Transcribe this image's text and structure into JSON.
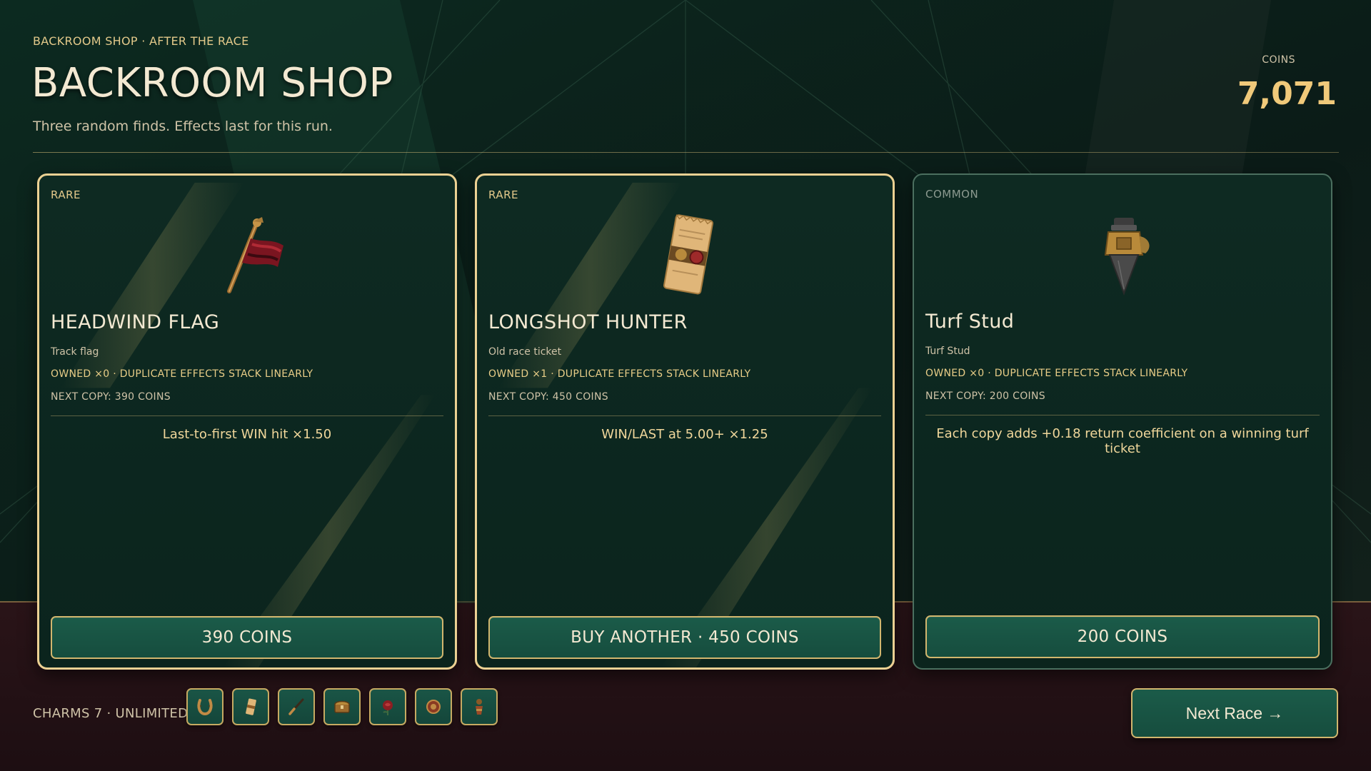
{
  "header": {
    "eyebrow": "BACKROOM SHOP · AFTER THE RACE",
    "title": "BACKROOM SHOP",
    "subtitle": "Three random finds. Effects last for this run.",
    "coins_label": "COINS",
    "coins_value": "7,071"
  },
  "cards": [
    {
      "rarity": "RARE",
      "icon": "headwind-flag-icon",
      "name": "HEADWIND FLAG",
      "subtitle": "Track flag",
      "owned": "OWNED ×0 · DUPLICATE EFFECTS STACK LINEARLY",
      "next_copy": "NEXT COPY: 390 COINS",
      "effect": "Last-to-first WIN hit ×1.50",
      "button": "390 COINS"
    },
    {
      "rarity": "RARE",
      "icon": "race-ticket-icon",
      "name": "LONGSHOT HUNTER",
      "subtitle": "Old race ticket",
      "owned": "OWNED ×1 · DUPLICATE EFFECTS STACK LINEARLY",
      "next_copy": "NEXT COPY: 450 COINS",
      "effect": "WIN/LAST at 5.00+ ×1.25",
      "button": "BUY ANOTHER · 450 COINS"
    },
    {
      "rarity": "COMMON",
      "icon": "turf-stud-icon",
      "name": "Turf Stud",
      "subtitle": "Turf Stud",
      "owned": "OWNED ×0 · DUPLICATE EFFECTS STACK LINEARLY",
      "next_copy": "NEXT COPY: 200 COINS",
      "effect": "Each copy adds +0.18 return coefficient on a winning turf ticket",
      "button": "200 COINS"
    }
  ],
  "footer": {
    "charms_label": "CHARMS 7 · UNLIMITED",
    "charms": [
      "horseshoe-icon",
      "ticket-icon",
      "riding-crop-icon",
      "chest-icon",
      "rose-icon",
      "medal-icon",
      "figurine-icon"
    ],
    "next_race": "Next Race →"
  },
  "colors": {
    "accent_gold": "#ecd193",
    "coins": "#f0c97a",
    "button_green": "#1b5b49",
    "panel": "#0e2a22"
  }
}
